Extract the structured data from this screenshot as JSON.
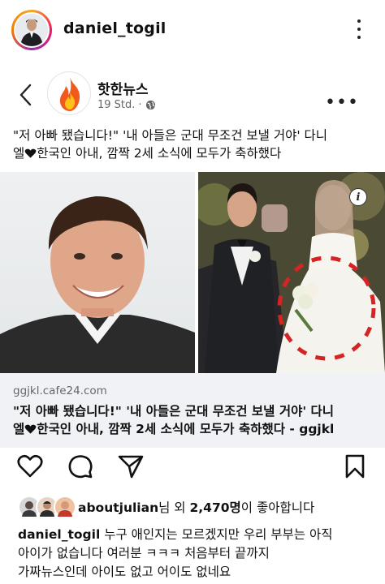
{
  "post": {
    "username": "daniel_togil"
  },
  "embed": {
    "page_name": "핫한뉴스",
    "timestamp": "19 Std.",
    "separator": "·",
    "text_line1": "\"저 아빠 됐습니다!\" '내 아들은 군대 무조건 보낼 거야' 다니",
    "text_line2_prefix": "엘",
    "text_line2_suffix": "한국인 아내, 깜짝 2세 소식에 모두가 축하했다",
    "info_label": "i",
    "link": {
      "domain": "ggjkl.cafe24.com",
      "title_line1": "\"저 아빠 됐습니다!\" '내 아들은 군대 무조건 보낼 거야' 다니",
      "title_line2_prefix": "엘",
      "title_line2_suffix": "한국인 아내, 깜짝 2세 소식에 모두가 축하했다 - ggjkl"
    }
  },
  "likes": {
    "liker": "aboutjulian",
    "middle": "님 외 ",
    "count": "2,470명",
    "suffix": "이 좋아합니다"
  },
  "caption": {
    "username": "daniel_togil",
    "text_line1": " 누구 애인지는 모르겠지만 우리 부부는 아직",
    "text_line2": "아이가 없습니다 여러분 ㅋㅋㅋ 처음부터 끝까지",
    "text_line3": "가짜뉴스인데 아이도 없고 어이도 없네요"
  },
  "icons": {
    "more": "more-vertical-icon",
    "back": "chevron-left-icon",
    "globe": "globe-icon",
    "like": "heart-icon",
    "comment": "comment-icon",
    "share": "send-icon",
    "save": "bookmark-icon",
    "heart_emoji": "black-heart-icon"
  },
  "colors": {
    "text": "#111111",
    "muted": "#65676b",
    "link_box": "#f0f2f5",
    "highlight": "#d62424"
  }
}
